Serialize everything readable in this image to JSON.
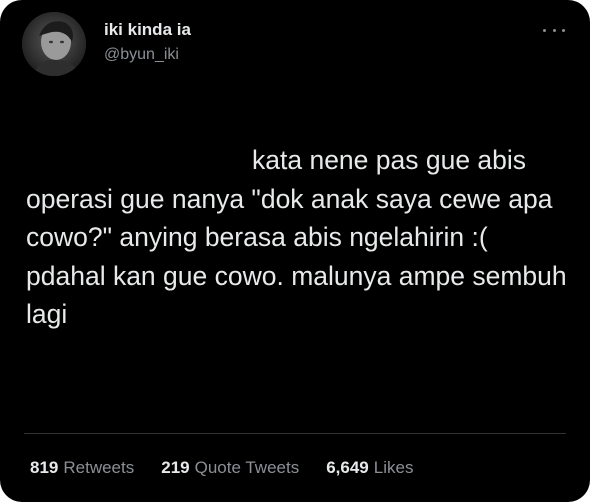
{
  "author": {
    "display_name": "iki kinda ia",
    "handle": "@byun_iki"
  },
  "tweet": {
    "text": "kata nene pas gue abis operasi gue nanya \"dok anak saya cewe apa cowo?\" anying berasa abis ngelahirin :( pdahal kan gue cowo. malunya ampe sembuh lagi"
  },
  "stats": {
    "retweets_count": "819",
    "retweets_label": "Retweets",
    "quotes_count": "219",
    "quotes_label": "Quote Tweets",
    "likes_count": "6,649",
    "likes_label": "Likes"
  },
  "icons": {
    "more": "more-horizontal-icon"
  },
  "colors": {
    "background": "#000000",
    "primary_text": "#e7e9ea",
    "secondary_text": "#8b8f94",
    "divider": "#2f3336"
  }
}
